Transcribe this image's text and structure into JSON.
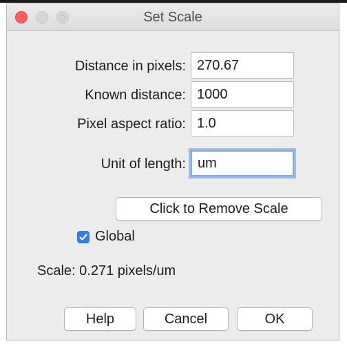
{
  "window": {
    "title": "Set Scale"
  },
  "form": {
    "fields": [
      {
        "label": "Distance in pixels:",
        "value": "270.67"
      },
      {
        "label": "Known distance:",
        "value": "1000"
      },
      {
        "label": "Pixel aspect ratio:",
        "value": "1.0"
      },
      {
        "label": "Unit of length:",
        "value": "um"
      }
    ]
  },
  "remove_scale_button": "Click to Remove Scale",
  "global_checkbox": {
    "label": "Global",
    "checked": true
  },
  "scale_readout": "Scale: 0.271 pixels/um",
  "buttons": {
    "help": "Help",
    "cancel": "Cancel",
    "ok": "OK"
  },
  "colors": {
    "close_button": "#fc5f57",
    "checkbox_accent": "#2f7de1",
    "focus_ring": "#7fa9e0"
  }
}
